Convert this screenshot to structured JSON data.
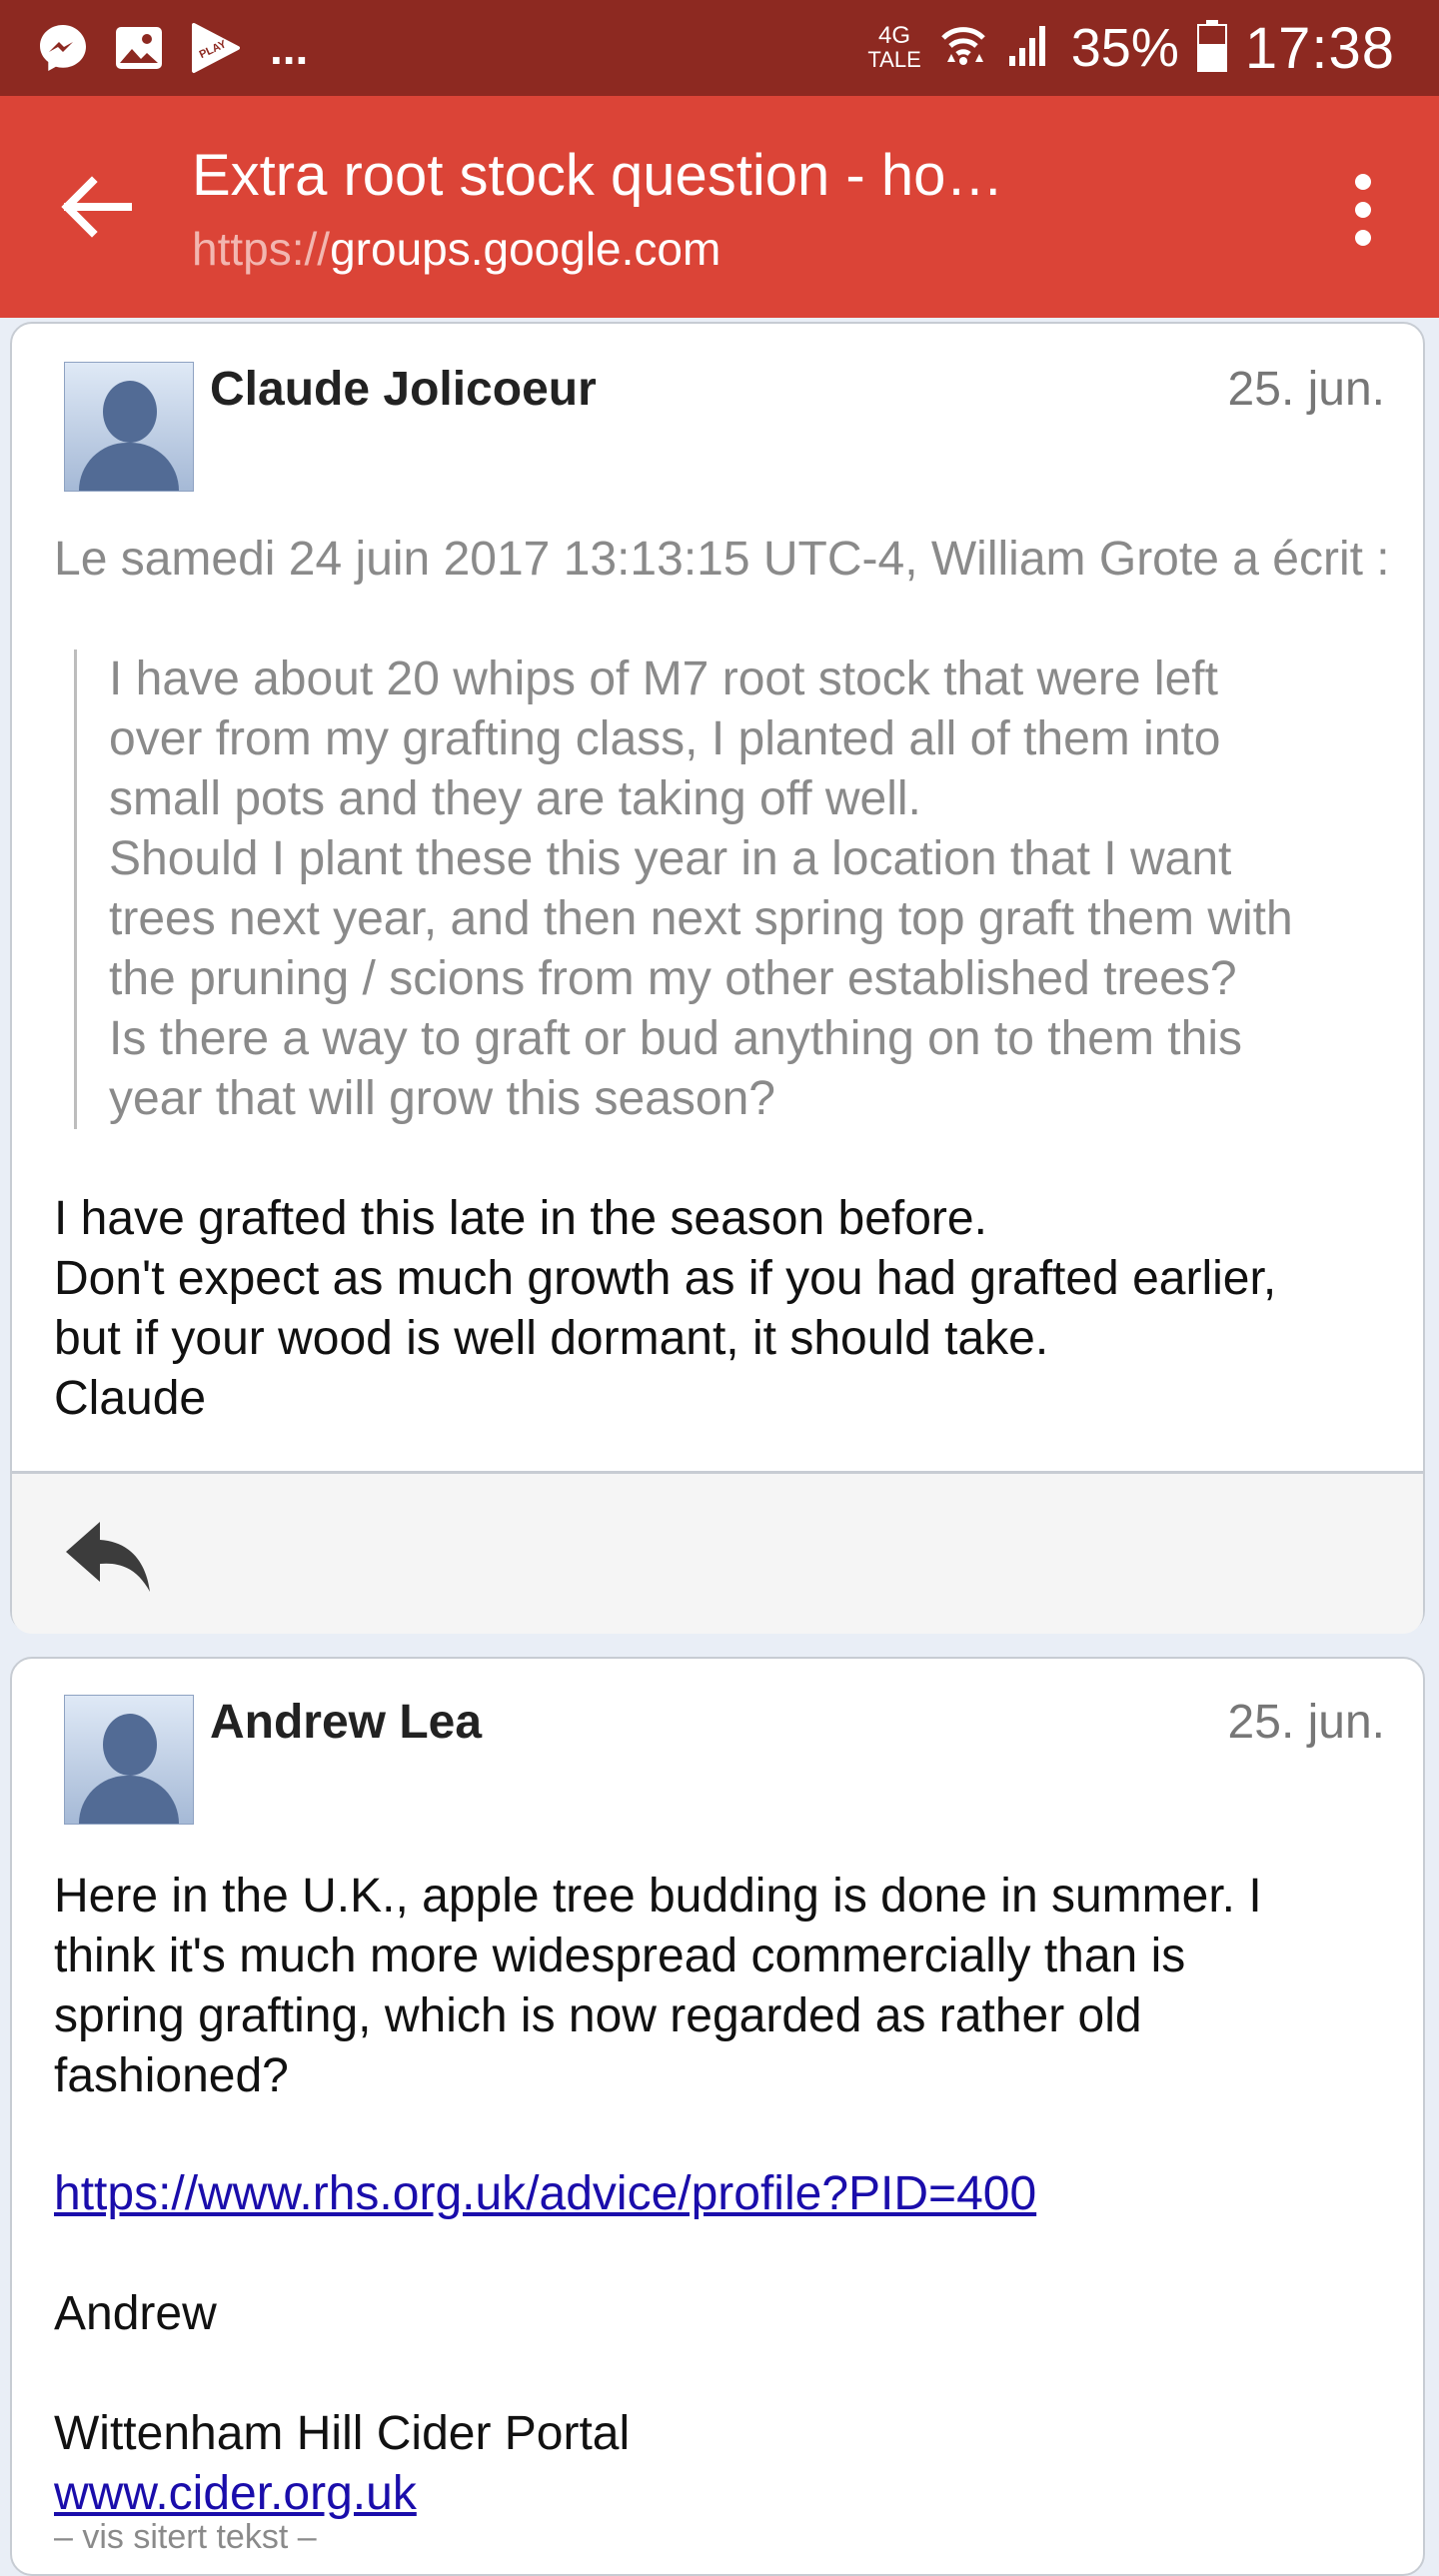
{
  "status_bar": {
    "network_top": "4G",
    "network_bottom": "TALE",
    "battery": "35%",
    "time": "17:38",
    "overflow": "...",
    "play_label": "PLAY"
  },
  "app_bar": {
    "title": "Extra root stock question - ho…",
    "url_scheme": "https://",
    "url_host": "groups.google.com"
  },
  "posts": [
    {
      "author": "Claude Jolicoeur",
      "date": "25. jun.",
      "quote_intro": "Le samedi 24 juin 2017 13:13:15 UTC-4, William Grote a écrit :",
      "quote_lines": [
        "I have about 20 whips of M7 root stock that were left",
        "over from my grafting class, I planted all of them into",
        "small pots and they are taking off well.",
        "Should I plant these this year in a location that I want",
        "trees next year, and then next spring top graft them with",
        "the pruning / scions from my other established trees?",
        "Is there a way to graft or bud anything on to them this",
        "year that will grow this season?"
      ],
      "body_lines": [
        "I have grafted this late in the season before.",
        "Don't expect as much growth as if you had grafted earlier,",
        "but if your wood is well dormant, it should take.",
        "Claude"
      ]
    },
    {
      "author": "Andrew Lea",
      "date": "25. jun.",
      "body_lines": [
        "Here in the U.K., apple tree budding is done in summer. I",
        "think it's much more widespread commercially than is",
        "spring grafting, which is now regarded as rather old",
        "fashioned?"
      ],
      "link": "https://www.rhs.org.uk/advice/profile?PID=400",
      "signature_name": "Andrew",
      "signature_org": "Wittenham Hill Cider Portal",
      "signature_link": "www.cider.org.uk",
      "show_quoted": "– vis sitert tekst –"
    }
  ],
  "colors": {
    "status_bar": "#8d2921",
    "app_bar": "#db4437",
    "link": "#1a0dab"
  },
  "icons": [
    "messenger-icon",
    "gallery-icon",
    "play-store-icon",
    "wifi-icon",
    "signal-icon",
    "battery-icon",
    "back-arrow-icon",
    "more-vert-icon",
    "reply-icon",
    "avatar-placeholder"
  ]
}
